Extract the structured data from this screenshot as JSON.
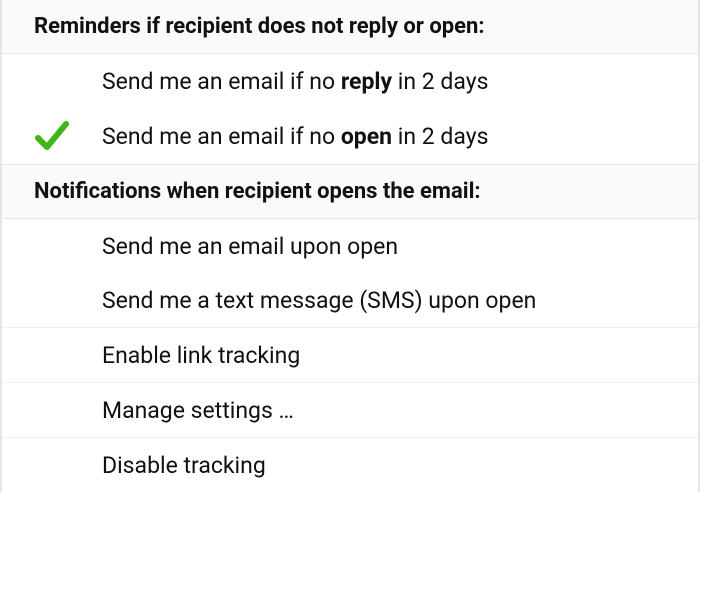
{
  "headers": {
    "reminders": "Reminders if recipient does not reply or open:",
    "notifications": "Notifications when recipient opens the email:"
  },
  "reminder_items": {
    "no_reply": {
      "prefix": "Send me an email if no ",
      "bold": "reply",
      "suffix": " in 2 days",
      "checked": false
    },
    "no_open": {
      "prefix": "Send me an email if no ",
      "bold": "open",
      "suffix": " in 2 days",
      "checked": true
    }
  },
  "notify_items": {
    "email_on_open": {
      "text": "Send me an email upon open",
      "checked": false
    },
    "sms_on_open": {
      "text": "Send me a text message (SMS) upon open",
      "checked": false
    }
  },
  "actions": {
    "enable_link_tracking": "Enable link tracking",
    "manage_settings": "Manage settings …",
    "disable_tracking": "Disable tracking"
  },
  "colors": {
    "check": "#3fb618"
  }
}
